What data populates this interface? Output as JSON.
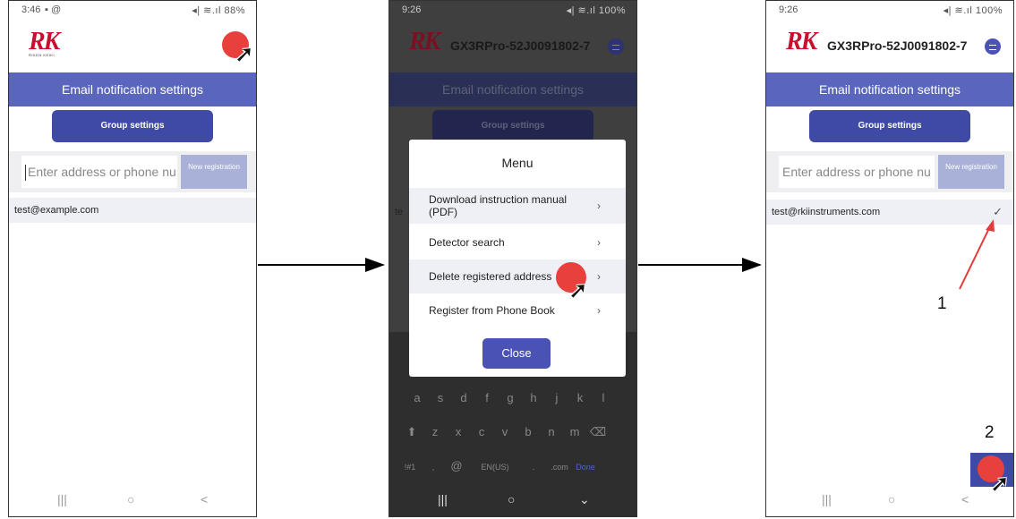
{
  "panel1": {
    "status_time": "3:46",
    "status_icons": "▪ @",
    "status_right": "◂| ≋.ıl 88%",
    "logo_text": "RK",
    "logo_sub": "RIKEN KEIKI",
    "header_title": "Email notification settings",
    "group_settings": "Group settings",
    "input_placeholder": "Enter address or phone nu",
    "new_registration": "New registration",
    "address": "test@example.com"
  },
  "panel2": {
    "status_time": "9:26",
    "status_right": "◂| ≋.ıl 100%",
    "logo_text": "RK",
    "device_name": "GX3RPro-52J0091802-7",
    "header_title": "Email notification settings",
    "group_settings": "Group settings",
    "behind_text": "te",
    "modal_title": "Menu",
    "menu_items": [
      "Download instruction manual (PDF)",
      "Detector search",
      "Delete registered address",
      "Register from Phone Book"
    ],
    "chevron": "›",
    "close_label": "Close",
    "keyboard_row1": [
      "a",
      "s",
      "d",
      "f",
      "g",
      "h",
      "j",
      "k",
      "l"
    ],
    "keyboard_row2": [
      "z",
      "x",
      "c",
      "v",
      "b",
      "n",
      "m"
    ],
    "keyboard_row3": [
      "!#1",
      ",",
      "@",
      "EN(US)",
      ".",
      ".com",
      "Done"
    ]
  },
  "panel3": {
    "status_time": "9:26",
    "status_right": "◂| ≋.ıl 100%",
    "logo_text": "RK",
    "device_name": "GX3RPro-52J0091802-7",
    "header_title": "Email notification settings",
    "group_settings": "Group settings",
    "input_placeholder": "Enter address or phone nu",
    "new_registration": "New registration",
    "address": "test@rkiinstruments.com",
    "checkmark": "✓",
    "annotation_1": "1",
    "annotation_2": "2"
  },
  "nav": {
    "recent": "|||",
    "home": "○",
    "back": "<"
  },
  "colors": {
    "header": "#5a66be",
    "button": "#3f4aa6",
    "accent_red": "#c8102e",
    "cursor_dot": "#e8403c"
  }
}
